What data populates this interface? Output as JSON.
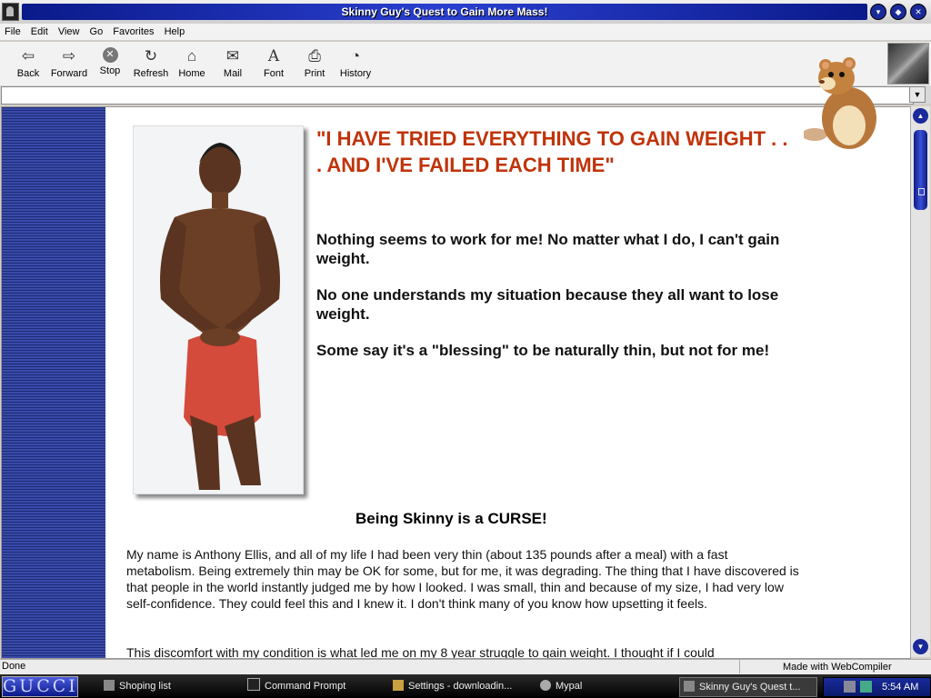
{
  "window": {
    "title": "Skinny Guy's Quest to Gain More Mass!"
  },
  "menu": [
    "File",
    "Edit",
    "View",
    "Go",
    "Favorites",
    "Help"
  ],
  "toolbar": [
    {
      "label": "Back",
      "icon": "back-arrow-icon",
      "glyph": "⇦"
    },
    {
      "label": "Forward",
      "icon": "forward-arrow-icon",
      "glyph": "⇨"
    },
    {
      "label": "Stop",
      "icon": "stop-icon",
      "glyph": "✕"
    },
    {
      "label": "Refresh",
      "icon": "refresh-icon",
      "glyph": "↻"
    },
    {
      "label": "Home",
      "icon": "home-icon",
      "glyph": "⌂"
    },
    {
      "label": "Mail",
      "icon": "mail-icon",
      "glyph": "✉"
    },
    {
      "label": "Font",
      "icon": "font-icon",
      "glyph": "A"
    },
    {
      "label": "Print",
      "icon": "print-icon",
      "glyph": "⎙"
    },
    {
      "label": "History",
      "icon": "history-icon",
      "glyph": "◔"
    }
  ],
  "address": {
    "value": ""
  },
  "content": {
    "headline": "\"I HAVE TRIED EVERYTHING TO GAIN WEIGHT . . . AND I'VE FAILED EACH TIME\"",
    "para1": "Nothing seems to work for me! No matter what I do, I can't gain weight.",
    "para2": "No one understands my situation because they all want to lose weight.",
    "para3": "Some say it's a \"blessing\" to be naturally thin, but not for me!",
    "subhead": "Being Skinny is a CURSE!",
    "body1": "My name is Anthony Ellis, and all of my life I had been very thin (about 135 pounds after a meal) with a fast metabolism. Being extremely thin may be OK for some, but for me, it was degrading. The thing that I have discovered is that people in the world instantly judged me by how I looked. I was small, thin and because of my size, I had very low self-confidence. They could feel this and I knew it. I don't think many of you know how upsetting it feels.",
    "body2": "This discomfort with my condition is what led me on my 8 year struggle to gain weight. I thought if I could"
  },
  "status": {
    "text": "Done",
    "made_with": "Made with WebCompiler"
  },
  "taskbar": {
    "start_label": "GUCCI",
    "tasks": [
      {
        "label": "Shoping list"
      },
      {
        "label": "Command Prompt"
      },
      {
        "label": "Settings - downloadin..."
      },
      {
        "label": "Mypal"
      },
      {
        "label": "Skinny Guy's Quest t..."
      }
    ],
    "clock": "5:54 AM"
  },
  "colors": {
    "headline": "#c0330a",
    "title_band": "#1a2a9a",
    "sidebar_stripe": "#1d2b78"
  }
}
